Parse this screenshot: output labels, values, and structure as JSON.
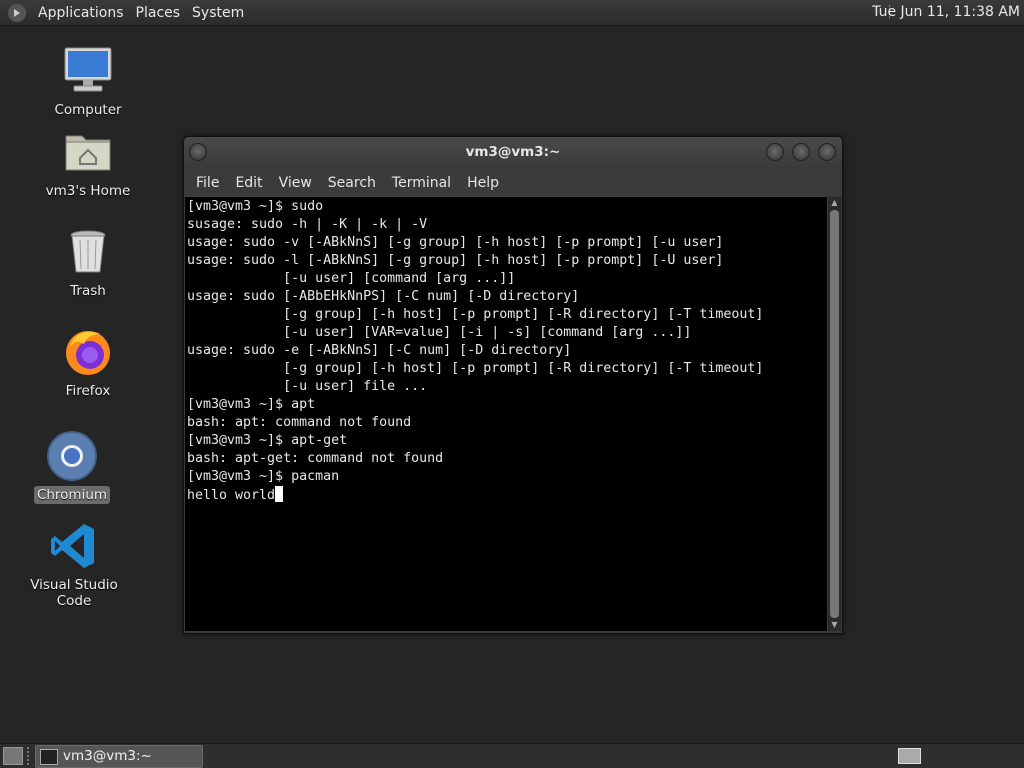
{
  "top_panel": {
    "menus": [
      "Applications",
      "Places",
      "System"
    ],
    "clock": "Tue Jun 11, 11:38 AM"
  },
  "desktop_icons": [
    {
      "label": "Computer",
      "icon": "computer-icon"
    },
    {
      "label": "vm3's Home",
      "icon": "home-folder-icon"
    },
    {
      "label": "Trash",
      "icon": "trash-icon"
    },
    {
      "label": "Firefox",
      "icon": "firefox-icon"
    },
    {
      "label": "Chromium",
      "icon": "chromium-icon",
      "selected": true
    },
    {
      "label": "Visual Studio Code",
      "icon": "vscode-icon"
    }
  ],
  "terminal": {
    "title": "vm3@vm3:~",
    "menu": [
      "File",
      "Edit",
      "View",
      "Search",
      "Terminal",
      "Help"
    ],
    "lines": [
      "[vm3@vm3 ~]$ sudo",
      "susage: sudo -h | -K | -k | -V",
      "usage: sudo -v [-ABkNnS] [-g group] [-h host] [-p prompt] [-u user]",
      "usage: sudo -l [-ABkNnS] [-g group] [-h host] [-p prompt] [-U user]",
      "            [-u user] [command [arg ...]]",
      "usage: sudo [-ABbEHkNnPS] [-C num] [-D directory]",
      "            [-g group] [-h host] [-p prompt] [-R directory] [-T timeout]",
      "            [-u user] [VAR=value] [-i | -s] [command [arg ...]]",
      "usage: sudo -e [-ABkNnS] [-C num] [-D directory]",
      "            [-g group] [-h host] [-p prompt] [-R directory] [-T timeout]",
      "            [-u user] file ...",
      "[vm3@vm3 ~]$ apt",
      "bash: apt: command not found",
      "[vm3@vm3 ~]$ apt-get",
      "bash: apt-get: command not found",
      "[vm3@vm3 ~]$ pacman"
    ],
    "current_line": "hello world"
  },
  "taskbar": {
    "task_label": "vm3@vm3:~"
  }
}
